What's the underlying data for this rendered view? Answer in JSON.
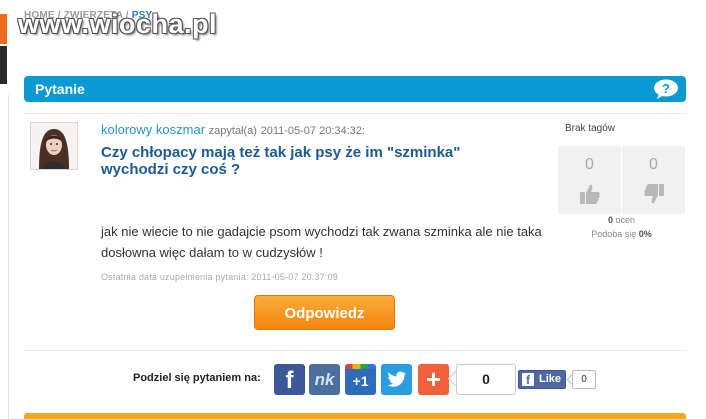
{
  "breadcrumb": {
    "items": [
      "HOME",
      "ZWIERZĘTA"
    ],
    "current": "PSY",
    "separator": " / "
  },
  "watermark": "www.wiocha.pl",
  "header": {
    "title": "Pytanie",
    "help_icon": "speech-bubble-question-icon"
  },
  "question": {
    "author": "kolorowy koszmar",
    "asked_label": "zapytał(a)",
    "asked_date": "2011-05-07 20:34:32:",
    "title": "Czy chłopacy mają też tak jak psy że im \"szminka\" wychodzi czy coś ?",
    "body": "jak nie wiecie to nie gadajcie psom wychodzi tak zwana szminka ale nie taka dosłowna więc dałam to w cudzysłów !",
    "updated": "Ostatnia data uzupełnienia pytania: 2011-05-07 20:37:09"
  },
  "answer_button": "Odpowiedz",
  "tags": {
    "empty_label": "Brak tagów"
  },
  "votes": {
    "up": "0",
    "down": "0",
    "ratings_count": "0",
    "ratings_label": " ocen",
    "likes_label": "Podoba się ",
    "likes_pct": "0%"
  },
  "share": {
    "label": "Podziel się pytaniem na:",
    "facebook_glyph": "f",
    "nk_glyph": "nk",
    "gplus_glyph": "+1",
    "more_glyph": "+",
    "count": "0",
    "fb_like_label": "Like",
    "fb_like_count": "0"
  },
  "colors": {
    "header": "#0a9ad3",
    "answer_button": "#f3850f",
    "author": "#2a8fca",
    "title": "#1c5a94"
  }
}
